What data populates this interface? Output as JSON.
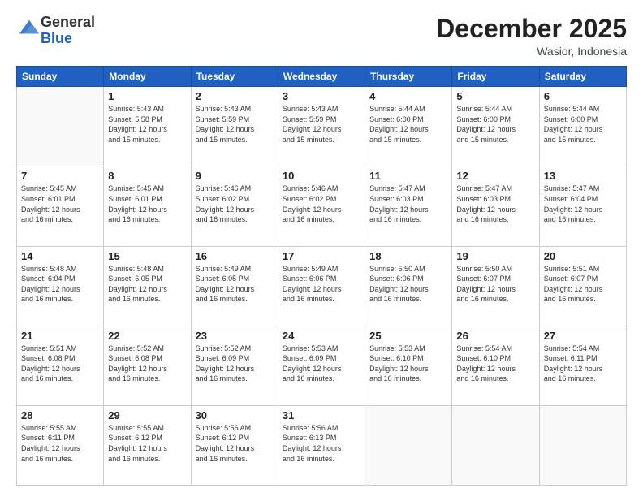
{
  "header": {
    "logo_line1": "General",
    "logo_line2": "Blue",
    "month": "December 2025",
    "location": "Wasior, Indonesia"
  },
  "weekdays": [
    "Sunday",
    "Monday",
    "Tuesday",
    "Wednesday",
    "Thursday",
    "Friday",
    "Saturday"
  ],
  "weeks": [
    [
      {
        "day": "",
        "info": ""
      },
      {
        "day": "1",
        "info": "Sunrise: 5:43 AM\nSunset: 5:58 PM\nDaylight: 12 hours\nand 15 minutes."
      },
      {
        "day": "2",
        "info": "Sunrise: 5:43 AM\nSunset: 5:59 PM\nDaylight: 12 hours\nand 15 minutes."
      },
      {
        "day": "3",
        "info": "Sunrise: 5:43 AM\nSunset: 5:59 PM\nDaylight: 12 hours\nand 15 minutes."
      },
      {
        "day": "4",
        "info": "Sunrise: 5:44 AM\nSunset: 6:00 PM\nDaylight: 12 hours\nand 15 minutes."
      },
      {
        "day": "5",
        "info": "Sunrise: 5:44 AM\nSunset: 6:00 PM\nDaylight: 12 hours\nand 15 minutes."
      },
      {
        "day": "6",
        "info": "Sunrise: 5:44 AM\nSunset: 6:00 PM\nDaylight: 12 hours\nand 15 minutes."
      }
    ],
    [
      {
        "day": "7",
        "info": "Sunrise: 5:45 AM\nSunset: 6:01 PM\nDaylight: 12 hours\nand 16 minutes."
      },
      {
        "day": "8",
        "info": "Sunrise: 5:45 AM\nSunset: 6:01 PM\nDaylight: 12 hours\nand 16 minutes."
      },
      {
        "day": "9",
        "info": "Sunrise: 5:46 AM\nSunset: 6:02 PM\nDaylight: 12 hours\nand 16 minutes."
      },
      {
        "day": "10",
        "info": "Sunrise: 5:46 AM\nSunset: 6:02 PM\nDaylight: 12 hours\nand 16 minutes."
      },
      {
        "day": "11",
        "info": "Sunrise: 5:47 AM\nSunset: 6:03 PM\nDaylight: 12 hours\nand 16 minutes."
      },
      {
        "day": "12",
        "info": "Sunrise: 5:47 AM\nSunset: 6:03 PM\nDaylight: 12 hours\nand 16 minutes."
      },
      {
        "day": "13",
        "info": "Sunrise: 5:47 AM\nSunset: 6:04 PM\nDaylight: 12 hours\nand 16 minutes."
      }
    ],
    [
      {
        "day": "14",
        "info": "Sunrise: 5:48 AM\nSunset: 6:04 PM\nDaylight: 12 hours\nand 16 minutes."
      },
      {
        "day": "15",
        "info": "Sunrise: 5:48 AM\nSunset: 6:05 PM\nDaylight: 12 hours\nand 16 minutes."
      },
      {
        "day": "16",
        "info": "Sunrise: 5:49 AM\nSunset: 6:05 PM\nDaylight: 12 hours\nand 16 minutes."
      },
      {
        "day": "17",
        "info": "Sunrise: 5:49 AM\nSunset: 6:06 PM\nDaylight: 12 hours\nand 16 minutes."
      },
      {
        "day": "18",
        "info": "Sunrise: 5:50 AM\nSunset: 6:06 PM\nDaylight: 12 hours\nand 16 minutes."
      },
      {
        "day": "19",
        "info": "Sunrise: 5:50 AM\nSunset: 6:07 PM\nDaylight: 12 hours\nand 16 minutes."
      },
      {
        "day": "20",
        "info": "Sunrise: 5:51 AM\nSunset: 6:07 PM\nDaylight: 12 hours\nand 16 minutes."
      }
    ],
    [
      {
        "day": "21",
        "info": "Sunrise: 5:51 AM\nSunset: 6:08 PM\nDaylight: 12 hours\nand 16 minutes."
      },
      {
        "day": "22",
        "info": "Sunrise: 5:52 AM\nSunset: 6:08 PM\nDaylight: 12 hours\nand 16 minutes."
      },
      {
        "day": "23",
        "info": "Sunrise: 5:52 AM\nSunset: 6:09 PM\nDaylight: 12 hours\nand 16 minutes."
      },
      {
        "day": "24",
        "info": "Sunrise: 5:53 AM\nSunset: 6:09 PM\nDaylight: 12 hours\nand 16 minutes."
      },
      {
        "day": "25",
        "info": "Sunrise: 5:53 AM\nSunset: 6:10 PM\nDaylight: 12 hours\nand 16 minutes."
      },
      {
        "day": "26",
        "info": "Sunrise: 5:54 AM\nSunset: 6:10 PM\nDaylight: 12 hours\nand 16 minutes."
      },
      {
        "day": "27",
        "info": "Sunrise: 5:54 AM\nSunset: 6:11 PM\nDaylight: 12 hours\nand 16 minutes."
      }
    ],
    [
      {
        "day": "28",
        "info": "Sunrise: 5:55 AM\nSunset: 6:11 PM\nDaylight: 12 hours\nand 16 minutes."
      },
      {
        "day": "29",
        "info": "Sunrise: 5:55 AM\nSunset: 6:12 PM\nDaylight: 12 hours\nand 16 minutes."
      },
      {
        "day": "30",
        "info": "Sunrise: 5:56 AM\nSunset: 6:12 PM\nDaylight: 12 hours\nand 16 minutes."
      },
      {
        "day": "31",
        "info": "Sunrise: 5:56 AM\nSunset: 6:13 PM\nDaylight: 12 hours\nand 16 minutes."
      },
      {
        "day": "",
        "info": ""
      },
      {
        "day": "",
        "info": ""
      },
      {
        "day": "",
        "info": ""
      }
    ]
  ]
}
